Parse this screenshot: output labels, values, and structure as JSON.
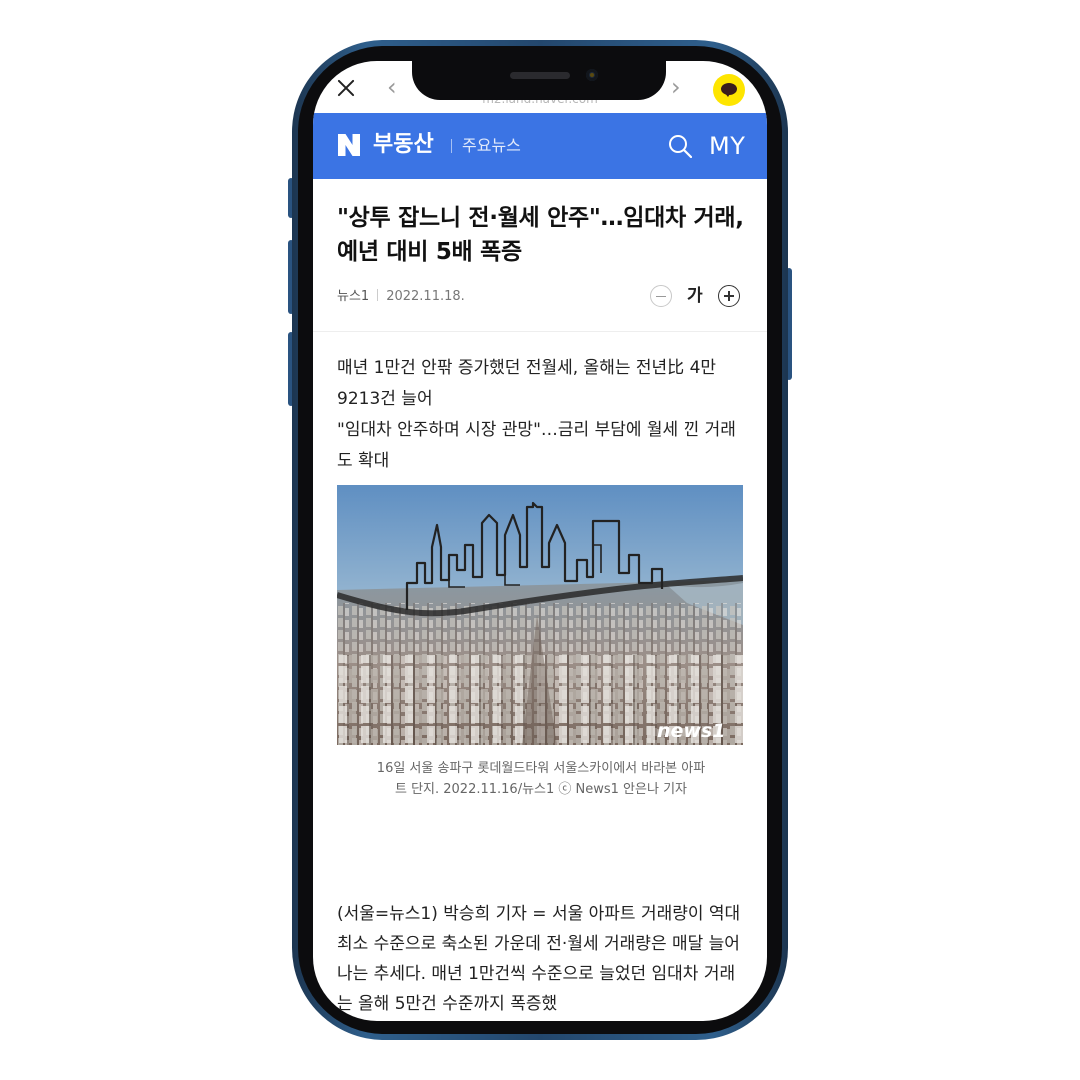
{
  "browser": {
    "url": "m2.land.naver.com",
    "back_arrow": "‹",
    "forward_arrow": "›",
    "close_icon": "close-icon",
    "kakaotalk_icon": "kakaotalk-icon"
  },
  "header": {
    "logo_letter": "N",
    "brand": "부동산",
    "section": "주요뉴스",
    "my_label": "MY",
    "background": "#3b74e4"
  },
  "article": {
    "title": "\"상투 잡느니 전·월세 안주\"…임대차 거래, 예년 대비 5배 폭증",
    "press": "뉴스1",
    "date": "2022.11.18.",
    "font_size_label": "가",
    "subtitle_lines": [
      "매년 1만건 안팎 증가했던 전월세, 올해는 전년比 4만9213건 늘어",
      "\"임대차 안주하며 시장 관망\"…금리 부담에 월세 낀 거래도 확대"
    ],
    "image_watermark": "news1",
    "caption": "16일 서울 송파구 롯데월드타워 서울스카이에서 바라본 아파트 단지. 2022.11.16/뉴스1 ⓒ News1 안은나 기자",
    "body": "(서울=뉴스1) 박승희 기자 = 서울 아파트 거래량이 역대 최소 수준으로 축소된 가운데 전·월세 거래량은 매달 늘어나는 추세다. 매년 1만건씩 수준으로 늘었던 임대차 거래는 올해 5만건 수준까지 폭증했"
  }
}
